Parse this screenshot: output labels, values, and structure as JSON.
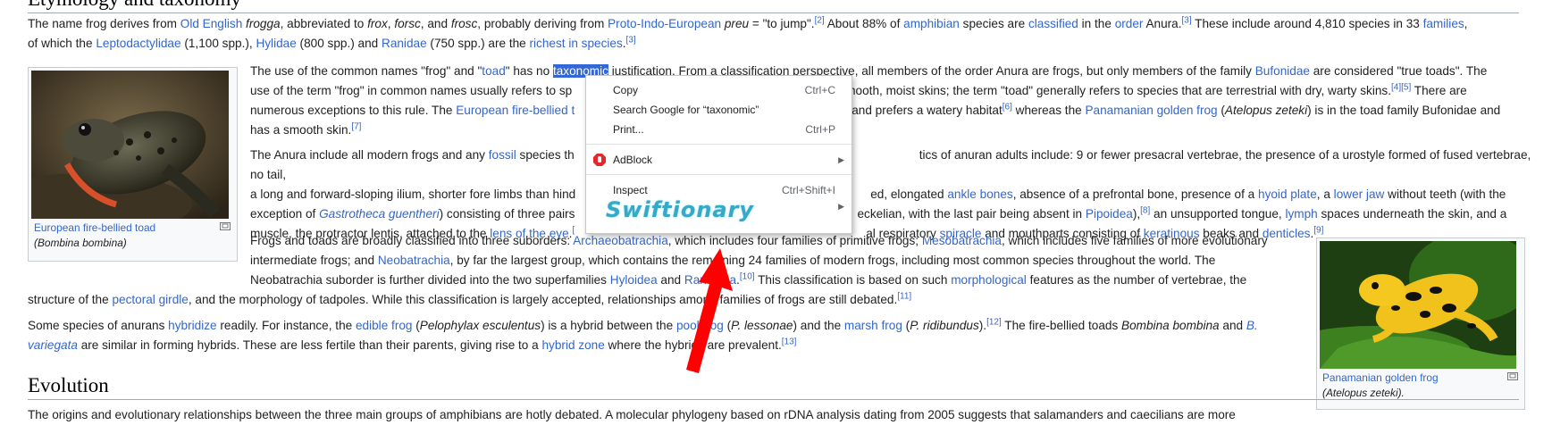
{
  "headings": {
    "etymology": "Etymology and taxonomy",
    "evolution": "Evolution"
  },
  "para1": {
    "t1": "The name frog derives from ",
    "l1": "Old English",
    "t2": " ",
    "i1": "frogga",
    "t3": ", abbreviated to ",
    "i2": "frox",
    "t4": ", ",
    "i3": "forsc",
    "t5": ", and ",
    "i4": "frosc",
    "t6": ", probably deriving from ",
    "l2": "Proto-Indo-European",
    "t7": " ",
    "i5": "preu",
    "t8": " = \"to jump\".",
    "r1": "[2]",
    "t9": " About 88% of ",
    "l3": "amphibian",
    "t10": " species are ",
    "l4": "classified",
    "t11": " in the ",
    "l5": "order",
    "t12": " Anura.",
    "r2": "[3]",
    "t13": " These include around 4,810 species in 33 ",
    "l6": "families",
    "t14": ",",
    "t15": "of which the ",
    "l7": "Leptodactylidae",
    "t16": " (1,100 spp.), ",
    "l8": "Hylidae",
    "t17": " (800 spp.) and ",
    "l9": "Ranidae",
    "t18": " (750 spp.) are the ",
    "l10": "richest in species",
    "t19": ".",
    "r3": "[3]"
  },
  "para2": {
    "a1": "The use of the common names \"frog\" and \"",
    "a2": "toad",
    "a3": "\" has no ",
    "a4": "taxonomic",
    "a5": " justification. From a classification perspective, all members of the order Anura are frogs, but only members of the family ",
    "a6": "Bufonidae",
    "a7": " are considered \"true toads\". The",
    "b1": "use of the term \"frog\" in common names usually refers to sp",
    "b2": "mooth, moist skins; the term \"toad\" generally refers to species that are terrestrial with dry, warty skins.",
    "b3": "[4][5]",
    "b4": " There are",
    "c1": "numerous exceptions to this rule. The ",
    "c2": "European fire-bellied t",
    "c3": "and prefers a watery habitat",
    "c4": "[6]",
    "c5": " whereas the ",
    "c6": "Panamanian golden frog",
    "c7": " (",
    "c8": "Atelopus zeteki",
    "c9": ") is in the toad family Bufonidae and",
    "d1": "has a smooth skin.",
    "d2": "[7]"
  },
  "para3": {
    "a1": "The Anura include all modern frogs and any ",
    "a2": "fossil",
    "a3": " species th",
    "a4": "tics of anuran adults include: 9 or fewer presacral vertebrae, the presence of a urostyle formed of fused vertebrae, no tail,",
    "b1": "a long and forward-sloping ilium, shorter fore limbs than hind",
    "b2": "ed, elongated ",
    "b3": "ankle bones",
    "b4": ", absence of a prefrontal bone, presence of a ",
    "b5": "hyoid plate",
    "b6": ", a ",
    "b7": "lower jaw",
    "b8": " without teeth (with the",
    "c1": "exception of ",
    "c2": "Gastrotheca guentheri",
    "c3": ") consisting of three pairs",
    "c4": "eckelian, with the last pair being absent in ",
    "c5": "Pipoidea",
    "c6": "),",
    "c7": "[8]",
    "c8": " an unsupported tongue, ",
    "c9": "lymph",
    "c10": " spaces underneath the skin, and a",
    "d1": "muscle, the protractor lentis, attached to the ",
    "d2": "lens of the eye",
    "d3": ".",
    "d4": "[",
    "d5": "al respiratory ",
    "d6": "spiracle",
    "d7": " and mouthparts consisting of ",
    "d8": "keratinous",
    "d9": " beaks and ",
    "d10": "denticles",
    "d11": ".",
    "d12": "[9]"
  },
  "para4": {
    "a1": "Frogs and toads are broadly classified into three suborders: ",
    "a2": "Archaeobatrachia",
    "a3": ", which includes four families of primitive frogs; ",
    "a4": "Mesobatrachia",
    "a5": ", which includes five families of more evolutionary",
    "b1": "intermediate frogs; and ",
    "b2": "Neobatrachia",
    "b3": ", by far the largest group, which contains the remaining 24 families of modern frogs, including most common species throughout the world. The",
    "c1": "Neobatrachia suborder is further divided into the two superfamilies ",
    "c2": "Hyloidea",
    "c3": " and ",
    "c4": "Ranoidea",
    "c5": ".",
    "c6": "[10]",
    "c7": " This classification is based on such ",
    "c8": "morphological",
    "c9": " features as the number of vertebrae, the",
    "d1": "structure of the ",
    "d2": "pectoral girdle",
    "d3": ", and the morphology of tadpoles. While this classification is largely accepted, relationships among families of frogs are still debated.",
    "d4": "[11]"
  },
  "para5": {
    "a1": "Some species of anurans ",
    "a2": "hybridize",
    "a3": " readily. For instance, the ",
    "a4": "edible frog",
    "a5": " (",
    "a6": "Pelophylax esculentus",
    "a7": ") is a hybrid between the ",
    "a8": "pool frog",
    "a9": " (",
    "a10": "P. lessonae",
    "a11": ") and the ",
    "a12": "marsh frog",
    "a13": " (",
    "a14": "P. ridibundus",
    "a15": ").",
    "a16": "[12]",
    "a17": " The fire-bellied toads ",
    "a18": "Bombina bombina",
    "a19": " and ",
    "a20": "B.",
    "b1": "variegata",
    "b2": " are similar in forming hybrids. These are less fertile than their parents, giving rise to a ",
    "b3": "hybrid zone",
    "b4": " where the hybrids are prevalent.",
    "b5": "[13]"
  },
  "evolution_line": "The origins and evolutionary relationships between the three main groups of amphibians are hotly debated. A molecular phylogeny based on rDNA analysis dating from 2005 suggests that salamanders and caecilians are more",
  "figures": {
    "left": {
      "caption_link": "European fire-bellied toad",
      "caption_sci": "(Bombina bombina)"
    },
    "right": {
      "caption_link": "Panamanian golden frog",
      "caption_sci": "(Atelopus zeteki)."
    }
  },
  "context_menu": {
    "items": [
      {
        "label": "Copy",
        "shortcut": "Ctrl+C"
      },
      {
        "label": "Search Google for “taxonomic”",
        "shortcut": ""
      },
      {
        "label": "Print...",
        "shortcut": "Ctrl+P"
      },
      {
        "label": "AdBlock",
        "shortcut": ""
      },
      {
        "label": "Inspect",
        "shortcut": "Ctrl+Shift+I"
      },
      {
        "label": "Swiftionary",
        "shortcut": ""
      }
    ]
  },
  "colors": {
    "link": "#3366cc",
    "selection": "#3367d6",
    "annotation_arrow": "#ff0000",
    "swiftionary": "#35a9c7"
  }
}
